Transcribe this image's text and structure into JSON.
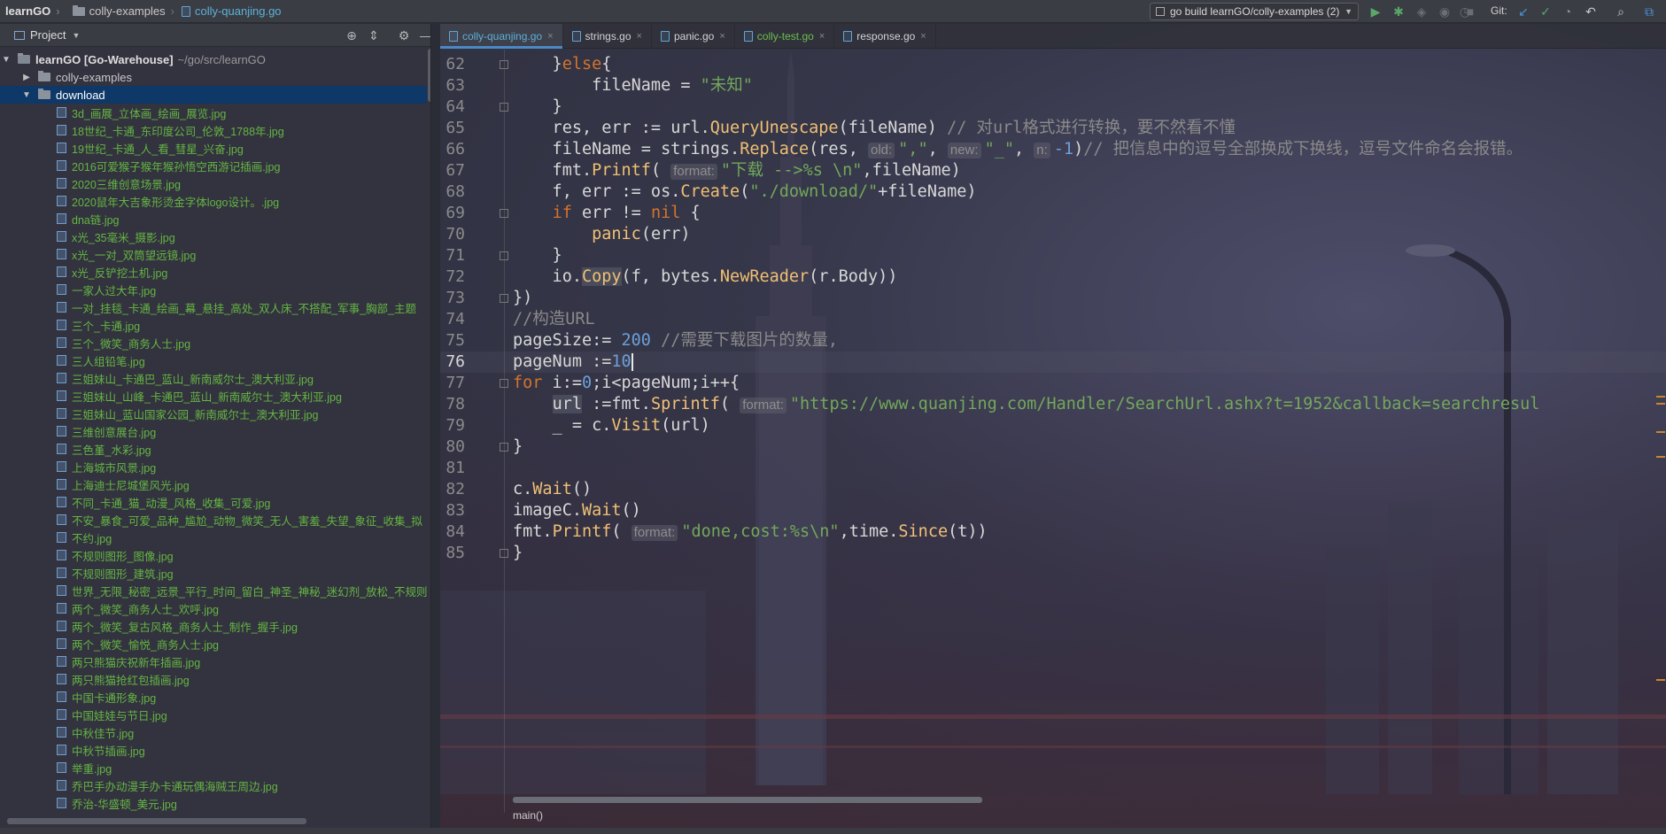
{
  "breadcrumb": {
    "root": "learnGO",
    "folder": "colly-examples",
    "file": "colly-quanjing.go"
  },
  "toolbar": {
    "run_config": "go build learnGO/colly-examples (2)",
    "git_label": "Git:"
  },
  "project_panel": {
    "title": "Project",
    "root_name": "learnGO [Go-Warehouse]",
    "root_path": "~/go/src/learnGO",
    "folders": [
      "colly-examples",
      "download"
    ],
    "files": [
      "3d_画展_立体画_绘画_展览.jpg",
      "18世纪_卡通_东印度公司_伦敦_1788年.jpg",
      "19世纪_卡通_人_看_彗星_兴奋.jpg",
      "2016可爱猴子猴年猴孙悟空西游记插画.jpg",
      "2020三维创意场景.jpg",
      "2020鼠年大吉象形烫金字体logo设计。.jpg",
      "dna链.jpg",
      "x光_35毫米_摄影.jpg",
      "x光_一对_双筒望远镜.jpg",
      "x光_反铲挖土机.jpg",
      "一家人过大年.jpg",
      "一对_挂毯_卡通_绘画_幕_悬挂_高处_双人床_不搭配_军事_胸部_主题",
      "三个_卡通.jpg",
      "三个_微笑_商务人士.jpg",
      "三人组铅笔.jpg",
      "三姐妹山_卡通巴_蓝山_新南威尔士_澳大利亚.jpg",
      "三姐妹山_山峰_卡通巴_蓝山_新南威尔士_澳大利亚.jpg",
      "三姐妹山_蓝山国家公园_新南威尔士_澳大利亚.jpg",
      "三维创意展台.jpg",
      "三色堇_水彩.jpg",
      "上海城市风景.jpg",
      "上海迪士尼城堡风光.jpg",
      "不同_卡通_猫_动漫_风格_收集_可爱.jpg",
      "不安_暴食_可爱_品种_尴尬_动物_微笑_无人_害羞_失望_象征_收集_拟",
      "不约.jpg",
      "不规则图形_图像.jpg",
      "不规则图形_建筑.jpg",
      "世界_无限_秘密_远景_平行_时间_留白_神圣_神秘_迷幻剂_放松_不规则",
      "两个_微笑_商务人士_欢呼.jpg",
      "两个_微笑_复古风格_商务人士_制作_握手.jpg",
      "两个_微笑_愉悦_商务人士.jpg",
      "两只熊猫庆祝新年插画.jpg",
      "两只熊猫抢红包插画.jpg",
      "中国卡通形象.jpg",
      "中国娃娃与节日.jpg",
      "中秋佳节.jpg",
      "中秋节插画.jpg",
      "举重.jpg",
      "乔巴手办动漫手办卡通玩偶海贼王周边.jpg",
      "乔治-华盛顿_美元.jpg"
    ]
  },
  "tabs": [
    {
      "label": "colly-quanjing.go",
      "state": "active"
    },
    {
      "label": "strings.go",
      "state": "normal"
    },
    {
      "label": "panic.go",
      "state": "normal"
    },
    {
      "label": "colly-test.go",
      "state": "test"
    },
    {
      "label": "response.go",
      "state": "normal"
    }
  ],
  "editor": {
    "line_numbers": [
      "62",
      "63",
      "64",
      "65",
      "66",
      "67",
      "68",
      "69",
      "70",
      "71",
      "72",
      "73",
      "74",
      "75",
      "76",
      "77",
      "78",
      "79",
      "80",
      "81",
      "82",
      "83",
      "84",
      "85"
    ],
    "current_line": "76",
    "strings": {
      "unknown": "\"未知\"",
      "comment_65": "// 对url格式进行转换，要不然看不懂",
      "comment_66": "// 把信息中的逗号全部换成下换线，逗号文件命名会报错。",
      "fmt_67": "\"下载 -->%s \\n\"",
      "path_68": "\"./download/\"",
      "comment_74": "//构造URL",
      "comment_75": "//需要下载图片的数量,",
      "url_78": "\"https://www.quanjing.com/Handler/SearchUrl.ashx?t=1952&callback=searchresul",
      "fmt_84": "\"done,cost:%s\\n\""
    },
    "numbers": {
      "page_size": "200",
      "page_num": "10",
      "neg_one": "-1",
      "zero": "0"
    },
    "hints": {
      "old": "old:",
      "new": "new:",
      "n": "n:",
      "format": "format:"
    },
    "footer_crumb": "main()"
  }
}
